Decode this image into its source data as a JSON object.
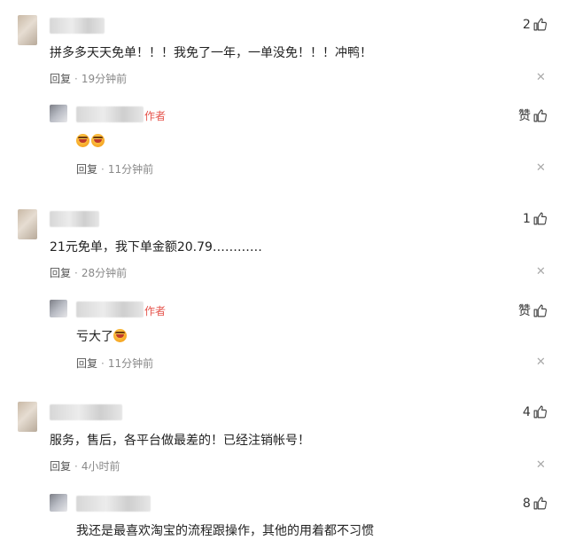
{
  "comments": [
    {
      "text": "拼多多天天免单！！！我免了一年，一单没免！！！冲鸭！",
      "reply_label": "回复",
      "time": "19分钟前",
      "likes": "2",
      "reply": {
        "author_tag": "作者",
        "like_label": "赞",
        "reply_label": "回复",
        "time": "11分钟前"
      }
    },
    {
      "text": "21元免单，我下单金额20.79…………",
      "reply_label": "回复",
      "time": "28分钟前",
      "likes": "1",
      "reply": {
        "author_tag": "作者",
        "like_label": "赞",
        "text": "亏大了",
        "reply_label": "回复",
        "time": "11分钟前"
      }
    },
    {
      "text": "服务，售后，各平台做最差的！已经注销帐号！",
      "reply_label": "回复",
      "time": "4小时前",
      "likes": "4"
    },
    {
      "text": "我还是最喜欢淘宝的流程跟操作，其他的用着都不习惯",
      "likes": "8"
    }
  ],
  "colors": {
    "author_tag": "#e5534b",
    "meta": "#888888"
  },
  "icons": {
    "like": "thumbs-up-icon",
    "close": "close-icon",
    "emoji": "laughing-emoji-icon"
  }
}
